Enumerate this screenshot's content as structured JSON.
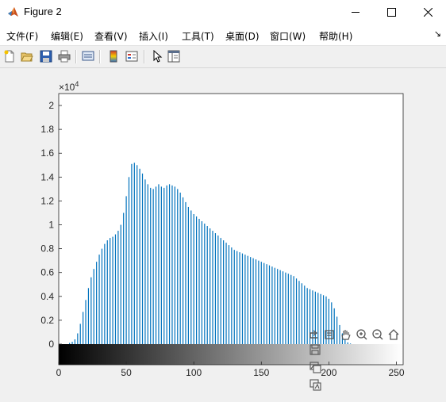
{
  "window": {
    "title": "Figure 2"
  },
  "menu": {
    "items": [
      "文件(F)",
      "编辑(E)",
      "查看(V)",
      "插入(I)",
      "工具(T)",
      "桌面(D)",
      "窗口(W)",
      "帮助(H)"
    ]
  },
  "chart_data": {
    "type": "bar",
    "title": "",
    "xlabel": "",
    "ylabel": "",
    "y_exponent_label": "×10",
    "y_exponent_power": "4",
    "xlim": [
      0,
      255
    ],
    "ylim": [
      0,
      21000
    ],
    "xticks": [
      "0",
      "50",
      "100",
      "150",
      "200",
      "250"
    ],
    "yticks": [
      "0",
      "0.2",
      "0.4",
      "0.6",
      "0.8",
      "1",
      "1.2",
      "1.4",
      "1.6",
      "1.8",
      "2"
    ],
    "grid": false,
    "colorbar": "grayscale",
    "bar_color": "#0072bd",
    "x": [
      0,
      2,
      4,
      6,
      8,
      10,
      12,
      14,
      16,
      18,
      20,
      22,
      24,
      26,
      28,
      30,
      32,
      34,
      36,
      38,
      40,
      42,
      44,
      46,
      48,
      50,
      52,
      54,
      56,
      58,
      60,
      62,
      64,
      66,
      68,
      70,
      72,
      74,
      76,
      78,
      80,
      82,
      84,
      86,
      88,
      90,
      92,
      94,
      96,
      98,
      100,
      102,
      104,
      106,
      108,
      110,
      112,
      114,
      116,
      118,
      120,
      122,
      124,
      126,
      128,
      130,
      132,
      134,
      136,
      138,
      140,
      142,
      144,
      146,
      148,
      150,
      152,
      154,
      156,
      158,
      160,
      162,
      164,
      166,
      168,
      170,
      172,
      174,
      176,
      178,
      180,
      182,
      184,
      186,
      188,
      190,
      192,
      194,
      196,
      198,
      200,
      202,
      204,
      206,
      208,
      210,
      212,
      214,
      216,
      218,
      220,
      222,
      224,
      226,
      228,
      230,
      232,
      234,
      236,
      238,
      240,
      242,
      244,
      246,
      248,
      250,
      252,
      254
    ],
    "values": [
      0,
      0,
      0,
      0,
      100,
      200,
      400,
      900,
      1700,
      2700,
      3700,
      4700,
      5600,
      6300,
      6900,
      7500,
      8000,
      8400,
      8700,
      8900,
      9000,
      9200,
      9500,
      10000,
      11000,
      12400,
      14000,
      15100,
      15200,
      15000,
      14700,
      14300,
      13800,
      13400,
      13100,
      13000,
      13200,
      13400,
      13200,
      13100,
      13300,
      13400,
      13300,
      13200,
      13000,
      12700,
      12300,
      11900,
      11500,
      11200,
      10900,
      10700,
      10500,
      10300,
      10100,
      9900,
      9700,
      9500,
      9300,
      9100,
      8900,
      8700,
      8500,
      8300,
      8100,
      7900,
      7800,
      7700,
      7600,
      7500,
      7400,
      7300,
      7200,
      7100,
      7000,
      6900,
      6800,
      6700,
      6600,
      6500,
      6400,
      6300,
      6200,
      6100,
      6000,
      5900,
      5800,
      5700,
      5500,
      5300,
      5100,
      4900,
      4700,
      4600,
      4500,
      4400,
      4300,
      4200,
      4100,
      4000,
      3800,
      3500,
      3000,
      2300,
      1600,
      900,
      400,
      150,
      50,
      0,
      0,
      0,
      0,
      0,
      0,
      0,
      0,
      0,
      0,
      0,
      0,
      0,
      0,
      0,
      0,
      0,
      0,
      0
    ]
  }
}
